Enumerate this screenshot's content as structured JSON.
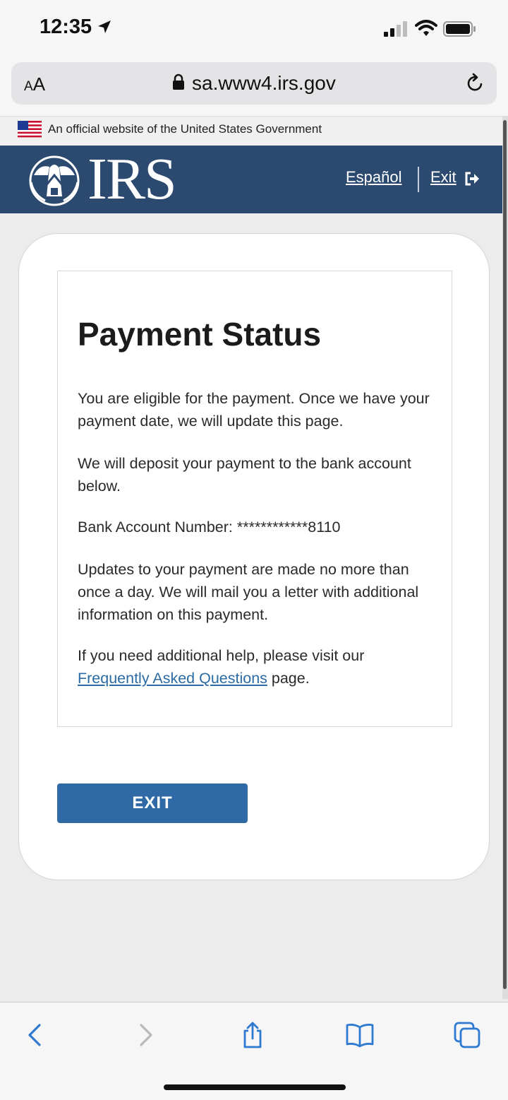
{
  "status_bar": {
    "time": "12:35"
  },
  "browser": {
    "aa_label_small": "A",
    "aa_label_large": "A",
    "url": "sa.www4.irs.gov"
  },
  "gov_banner": {
    "text": "An official website of the United States Government"
  },
  "header": {
    "logo_text": "IRS",
    "espanol_link": "Español",
    "exit_link": "Exit",
    "background_color": "#2c4a70"
  },
  "main": {
    "title": "Payment Status",
    "paragraph1": "You are eligible for the payment. Once we have your payment date, we will update this page.",
    "paragraph2": "We will deposit your payment to the bank account below.",
    "bank_account": "Bank Account Number: ************8110",
    "paragraph4": "Updates to your payment are made no more than once a day. We will mail you a letter with additional information on this payment.",
    "help_prefix": "If you need additional help, please visit our ",
    "faq_link": "Frequently Asked Questions",
    "help_suffix": " page.",
    "exit_button": "EXIT",
    "button_color": "#2f6aa6",
    "link_color": "#2b6aa3"
  },
  "icons": {
    "location": "location-arrow-icon",
    "signal": "cellular-signal-icon",
    "wifi": "wifi-icon",
    "battery": "battery-icon",
    "lock": "lock-icon",
    "reload": "reload-icon",
    "flag": "us-flag-icon",
    "eagle": "irs-eagle-icon",
    "exit_arrow": "exit-arrow-icon",
    "back": "back-chevron-icon",
    "forward": "forward-chevron-icon",
    "share": "share-icon",
    "bookmarks": "bookmarks-icon",
    "tabs": "tabs-icon"
  }
}
